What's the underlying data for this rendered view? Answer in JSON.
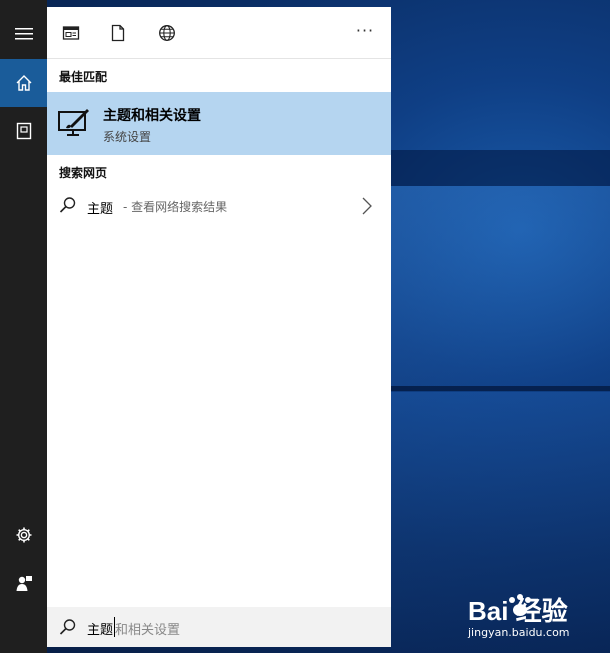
{
  "desktop": {
    "watermark_brand": "Bai 经验",
    "watermark_url": "jingyan.baidu.com"
  },
  "rail": {
    "items": [
      {
        "name": "hamburger-menu",
        "icon": "hamburger-icon"
      },
      {
        "name": "home",
        "icon": "home-icon",
        "active": true
      },
      {
        "name": "notebook",
        "icon": "notebook-icon"
      },
      {
        "name": "settings",
        "icon": "gear-icon"
      },
      {
        "name": "feedback",
        "icon": "feedback-icon"
      }
    ]
  },
  "toolbar": {
    "filters": [
      {
        "name": "apps-filter",
        "icon": "app-window-icon"
      },
      {
        "name": "documents-filter",
        "icon": "document-icon"
      },
      {
        "name": "web-filter",
        "icon": "globe-icon"
      }
    ],
    "more_label": "···"
  },
  "results": {
    "best_match_header": "最佳匹配",
    "best_match": {
      "title": "主题和相关设置",
      "subtitle": "系统设置",
      "icon": "theme-settings-icon"
    },
    "web_header": "搜索网页",
    "web_result": {
      "query": "主题",
      "suffix": "- 查看网络搜索结果"
    }
  },
  "search": {
    "typed_text": "主题",
    "suggestion_text": "和相关设置"
  },
  "colors": {
    "rail_bg": "#1f1f1f",
    "active_rail": "#1a5c9a",
    "highlight": "#b5d5f0",
    "searchbox_bg": "#f2f2f2"
  }
}
